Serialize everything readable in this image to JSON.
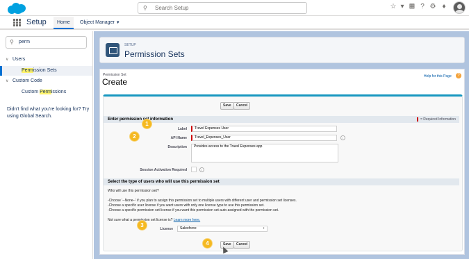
{
  "header": {
    "search_placeholder": "Search Setup"
  },
  "nav": {
    "app_name": "Setup",
    "tabs": [
      {
        "label": "Home"
      },
      {
        "label": "Object Manager"
      }
    ]
  },
  "sidebar": {
    "quick_find_value": "perm",
    "groups": [
      {
        "label": "Users",
        "item_pre": "",
        "item_hl": "Perm",
        "item_post": "ission Sets"
      },
      {
        "label": "Custom Code",
        "item_pre": "Custom ",
        "item_hl": "Perm",
        "item_post": "issions"
      }
    ],
    "help_text": "Didn't find what you're looking for? Try using Global Search."
  },
  "page_header": {
    "eyebrow": "SETUP",
    "title": "Permission Sets"
  },
  "panel": {
    "crumb": "Permission Set",
    "title": "Create",
    "help_link": "Help for this Page",
    "save_label": "Save",
    "cancel_label": "Cancel",
    "section1": {
      "heading": "Enter permission set information",
      "required_legend": "= Required Information",
      "fields": [
        {
          "label": "Label",
          "value": "Travel Expenses User"
        },
        {
          "label": "API Name",
          "value": "Travel_Expenses_User"
        },
        {
          "label": "Description",
          "value": "Provides access to the Travel Expenses app"
        },
        {
          "label": "Session Activation Required",
          "value": ""
        }
      ]
    },
    "section2": {
      "heading": "Select the type of users who will use this permission set",
      "question": "Who will use this permission set?",
      "bullets": [
        "-Choose '--None--' if you plan to assign this permission set to multiple users with different user and permission set licenses.",
        "-Choose a specific user license if you want users with only one license type to use this permission set.",
        "-Choose a specific permission set license if you want this permission set auto-assigned with the permission set."
      ],
      "not_sure": "Not sure what a permission set license is?",
      "learn_more": "Learn more here.",
      "license_label": "License",
      "license_value": "Salesforce"
    }
  },
  "callouts": [
    "1",
    "2",
    "3",
    "4"
  ],
  "colors": {
    "brand": "#00a1e0",
    "main_bg": "#b0c4df",
    "callout": "#f5b921",
    "required": "#cc0000"
  }
}
